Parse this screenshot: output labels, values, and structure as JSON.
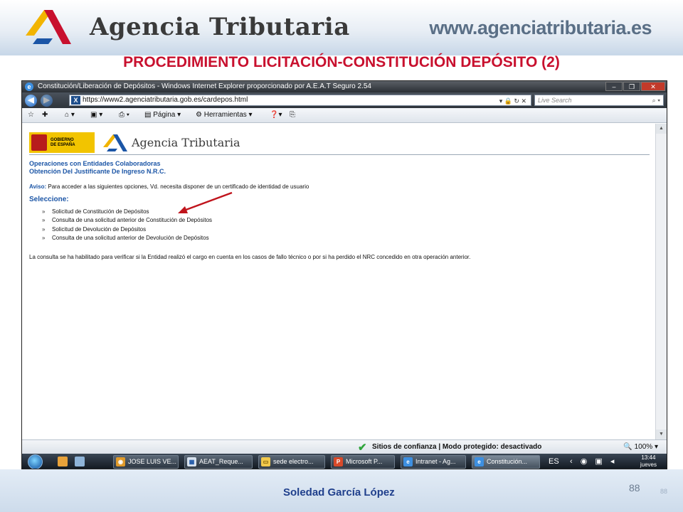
{
  "slide": {
    "brand_title": "Agencia Tributaria",
    "brand_url": "www.agenciatributaria.es",
    "title": "PROCEDIMIENTO LICITACIÓN-CONSTITUCIÓN DEPÓSITO (2)",
    "author": "Soledad García López",
    "page_number": "88",
    "page_number_ghost": "88"
  },
  "browser": {
    "window_title": "Constitución/Liberación de Depósitos - Windows Internet Explorer proporcionado por A.E.A.T Seguro 2.54",
    "url": "https://www2.agenciatributaria.gob.es/cardepos.html",
    "search_placeholder": "Live Search",
    "toolbar": {
      "page_label": "Página",
      "tools_label": "Herramientas"
    },
    "status_text": "Sitios de confianza | Modo protegido: desactivado",
    "zoom": "100%"
  },
  "page": {
    "gov_label_line1": "GOBIERNO",
    "gov_label_line2": "DE ESPAÑA",
    "brand": "Agencia Tributaria",
    "heading1": "Operaciones con Entidades Colaboradoras",
    "heading2": "Obtención Del Justificante De Ingreso N.R.C.",
    "notice_label": "Aviso:",
    "notice_text": "Para acceder a las siguientes opciones, Vd. necesita disponer de un certificado de identidad de usuario",
    "select_label": "Seleccione:",
    "bullet": "»",
    "options": [
      "Solicitud de Constitución de Depósitos",
      "Consulta de una solicitud anterior de Constitución de Depósitos",
      "Solicitud de Devolución de Depósitos",
      "Consulta de una solicitud anterior de Devolución de Depósitos"
    ],
    "footnote": "La consulta se ha habilitado para verificar si la Entidad realizó el cargo en cuenta en los casos de fallo técnico o por si ha perdido el NRC concedido en otra operación anterior."
  },
  "taskbar": {
    "items": [
      "JOSE LUIS VE...",
      "AEAT_Reque...",
      "sede electro...",
      "Microsoft P...",
      "Intranet - Ag...",
      "Constitución..."
    ],
    "language": "ES",
    "clock_time": "13:44",
    "clock_day": "jueves"
  },
  "colors": {
    "title_red": "#c8102e",
    "link_blue": "#1b55a6",
    "arrow_red": "#c0141c",
    "author_blue": "#1f3f8c"
  },
  "icons": [
    "agencia-logo-icon",
    "back-icon",
    "forward-icon",
    "favorites-icon",
    "home-icon",
    "print-icon",
    "help-icon",
    "check-icon",
    "windows-start-icon"
  ]
}
